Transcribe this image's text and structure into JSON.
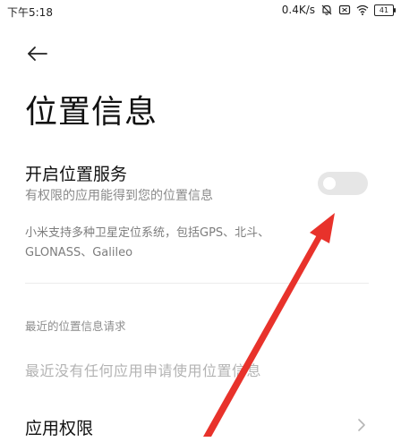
{
  "status_bar": {
    "time": "下午5:18",
    "network_speed": "0.4K/s",
    "battery": "41",
    "icons": [
      "mute-bell-icon",
      "notification-box-icon",
      "wifi-icon",
      "battery-icon"
    ]
  },
  "header": {
    "back_icon": "back-arrow-icon",
    "title": "位置信息"
  },
  "location_service": {
    "title": "开启位置服务",
    "subtitle": "有权限的应用能得到您的位置信息",
    "enabled": false
  },
  "description": {
    "line1": "小米支持多种卫星定位系统，包括GPS、北斗、",
    "line2": "GLONASS、Galileo"
  },
  "recent_requests": {
    "section_label": "最近的位置信息请求",
    "empty_text": "最近没有任何应用申请使用位置信息"
  },
  "app_permissions": {
    "label": "应用权限",
    "icon": "chevron-right-icon"
  },
  "colors": {
    "annotation_arrow": "#e8322b",
    "toggle_off": "#e6e6e6",
    "secondary_text": "#8a8a8a"
  }
}
